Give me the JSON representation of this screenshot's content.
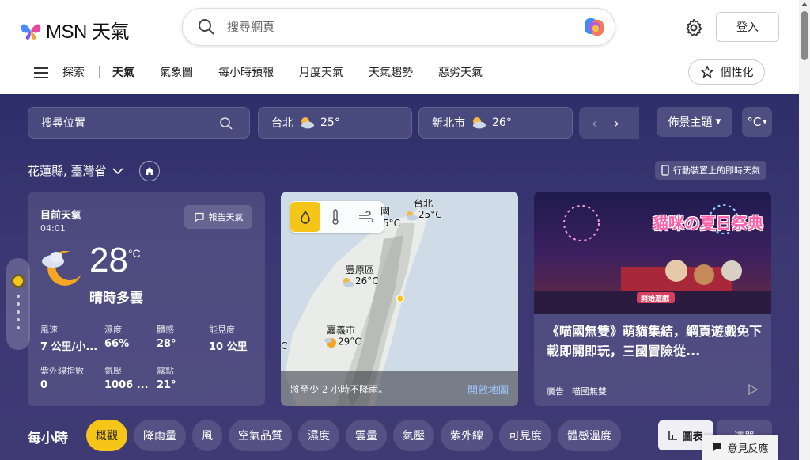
{
  "header": {
    "brand": "MSN 天氣",
    "search_placeholder": "搜尋網頁",
    "signin_label": "登入"
  },
  "nav": {
    "explore": "探索",
    "items": [
      "天氣",
      "氣象圖",
      "每小時預報",
      "月度天氣",
      "天氣趨勢",
      "惡劣天氣"
    ],
    "personalize": "個性化"
  },
  "toolbar": {
    "location_search": "搜尋位置",
    "chips": [
      {
        "city": "台北",
        "temp": "25°"
      },
      {
        "city": "新北市",
        "temp": "26°"
      }
    ],
    "theme": "佈景主題",
    "unit": "°C"
  },
  "location": {
    "name": "花蓮縣, 臺灣省",
    "mobile_link": "行動裝置上的即時天氣"
  },
  "current": {
    "label": "目前天氣",
    "time": "04:01",
    "report": "報告天氣",
    "temp": "28",
    "unit": "°C",
    "condition": "晴時多雲",
    "stats": [
      {
        "k": "風速",
        "v": "7 公里/小..."
      },
      {
        "k": "濕度",
        "v": "66%"
      },
      {
        "k": "體感",
        "v": "28°"
      },
      {
        "k": "能見度",
        "v": "10 公里"
      },
      {
        "k": "紫外線指數",
        "v": "0"
      },
      {
        "k": "氣壓",
        "v": "1006 ..."
      },
      {
        "k": "露點",
        "v": "21°"
      }
    ]
  },
  "map": {
    "labels": [
      {
        "name": "台北",
        "temp": "25°C"
      },
      {
        "name": "豐原區",
        "temp": "26°C"
      },
      {
        "name": "嘉義市",
        "temp": "29°C"
      }
    ],
    "partial_label": "國",
    "partial_temp": "5°C",
    "edge_label": "C",
    "footer": "將至少 2 小時不降雨。",
    "open": "開啟地圖"
  },
  "ad": {
    "title": "《喵國無雙》萌貓集結，網頁遊戲免下載即開即玩，三國冒險從...",
    "tag": "廣告",
    "sponsor": "喵國無雙",
    "banner_title": "貓咪の夏日祭典",
    "banner_button": "開始遊戲"
  },
  "hourly": {
    "title": "每小時",
    "pills": [
      "概觀",
      "降雨量",
      "風",
      "空氣品質",
      "濕度",
      "雲量",
      "氣壓",
      "紫外線",
      "可見度",
      "體感溫度"
    ],
    "chart": "圖表",
    "list": "清單"
  },
  "feedback": "意見反應",
  "colors": {
    "accent": "#f5c518",
    "bg_top": "#2d2f6a",
    "bg_bottom": "#3f3a74"
  }
}
